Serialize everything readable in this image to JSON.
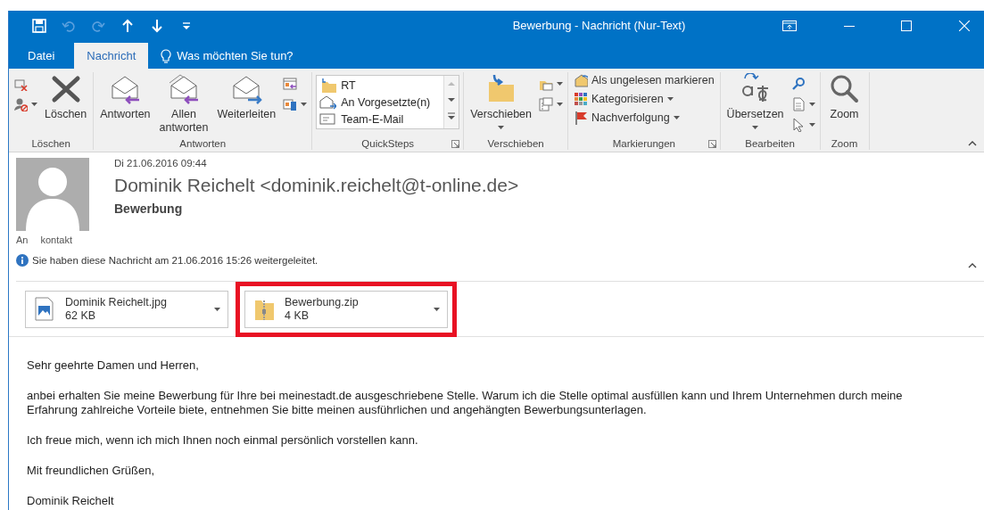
{
  "window": {
    "title": "Bewerbung - Nachricht (Nur-Text)"
  },
  "quick_access": [
    {
      "disabled": false
    },
    {
      "disabled": true
    },
    {
      "disabled": true
    },
    {
      "disabled": false
    },
    {
      "disabled": false
    },
    {
      "disabled": false
    }
  ],
  "tabs": [
    {
      "label": "Datei",
      "selected": false
    },
    {
      "label": "Nachricht",
      "selected": true
    }
  ],
  "tell_me": {
    "placeholder": "Was möchten Sie tun?"
  },
  "ribbon": [
    {
      "label": "Löschen",
      "launcher": false,
      "items": [
        {
          "kind": "icons",
          "buttons": [
            {
              "dropdown": false
            },
            {
              "dropdown": true
            }
          ]
        },
        {
          "kind": "large",
          "label": "Löschen",
          "dropdown": false
        }
      ]
    },
    {
      "label": "Antworten",
      "launcher": false,
      "items": [
        {
          "kind": "large",
          "label": "Antworten",
          "dropdown": false
        },
        {
          "kind": "large",
          "label": "Allen antworten",
          "dropdown": false
        },
        {
          "kind": "large",
          "label": "Weiterleiten",
          "dropdown": false
        },
        {
          "kind": "icons",
          "buttons": [
            {
              "dropdown": false
            },
            {
              "dropdown": true
            }
          ]
        }
      ]
    },
    {
      "label": "QuickSteps",
      "launcher": true,
      "items": [
        {
          "kind": "gallery",
          "entries": [
            "RT",
            "An Vorgesetzte(n)",
            "Team-E-Mail"
          ]
        }
      ]
    },
    {
      "label": "Verschieben",
      "launcher": false,
      "items": [
        {
          "kind": "large",
          "label": "Verschieben",
          "dropdown": true
        },
        {
          "kind": "icons",
          "buttons": [
            {
              "dropdown": true
            },
            {
              "dropdown": true
            }
          ]
        }
      ]
    },
    {
      "label": "Markierungen",
      "launcher": true,
      "items": [
        {
          "kind": "rows",
          "rows": [
            {
              "label": "Als ungelesen markieren",
              "dropdown": false
            },
            {
              "label": "Kategorisieren",
              "dropdown": true
            },
            {
              "label": "Nachverfolgung",
              "dropdown": true
            }
          ]
        }
      ]
    },
    {
      "label": "Bearbeiten",
      "launcher": false,
      "items": [
        {
          "kind": "large",
          "label": "Übersetzen",
          "dropdown": true
        },
        {
          "kind": "icons",
          "buttons": [
            {
              "dropdown": false
            },
            {
              "dropdown": true
            },
            {
              "dropdown": true
            }
          ]
        }
      ]
    },
    {
      "label": "Zoom",
      "launcher": false,
      "items": [
        {
          "kind": "large",
          "label": "Zoom",
          "dropdown": false
        }
      ]
    }
  ],
  "message": {
    "date": "Di 21.06.2016 09:44",
    "sender": "Dominik Reichelt <dominik.reichelt@t-online.de>",
    "subject": "Bewerbung",
    "to_label": "An",
    "to": "kontakt",
    "info": "Sie haben diese Nachricht am 21.06.2016 15:26 weitergeleitet."
  },
  "attachments": [
    {
      "name": "Dominik Reichelt.jpg",
      "size": "62 KB",
      "highlighted": false
    },
    {
      "name": "Bewerbung.zip",
      "size": "4 KB",
      "highlighted": true
    }
  ],
  "body": [
    "Sehr geehrte Damen und Herren,",
    "anbei erhalten Sie meine Bewerbung für Ihre bei meinestadt.de ausgeschriebene Stelle. Warum ich die Stelle optimal ausfüllen kann und Ihrem Unternehmen durch meine Erfahrung zahlreiche Vorteile biete, entnehmen Sie bitte meinen ausführlichen und angehängten Bewerbungsunterlagen.",
    "Ich freue mich, wenn ich mich Ihnen noch einmal persönlich vorstellen kann.",
    "Mit freundlichen Grüßen,",
    "Dominik Reichelt"
  ]
}
